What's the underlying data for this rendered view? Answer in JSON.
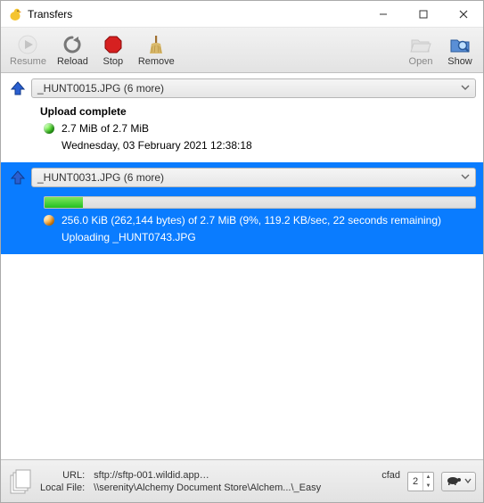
{
  "window": {
    "title": "Transfers"
  },
  "toolbar": {
    "resume": "Resume",
    "reload": "Reload",
    "stop": "Stop",
    "remove": "Remove",
    "open": "Open",
    "show": "Show"
  },
  "transfers": [
    {
      "filename": "_HUNT0015.JPG (6 more)",
      "complete_label": "Upload complete",
      "size_line": "2.7 MiB of 2.7 MiB",
      "time_line": "Wednesday, 03 February 2021 12:38:18",
      "selected": false,
      "status": "done"
    },
    {
      "filename": "_HUNT0031.JPG (6 more)",
      "progress_percent": 9,
      "progress_line": "256.0 KiB (262,144 bytes) of 2.7 MiB (9%, 119.2 KB/sec, 22 seconds remaining)",
      "uploading_line": "Uploading _HUNT0743.JPG",
      "selected": true,
      "status": "active"
    }
  ],
  "statusbar": {
    "url_label": "URL:",
    "url_value": "sftp://sftp-001.wildid.app…",
    "url_tail": "cfad",
    "local_label": "Local File:",
    "local_value": "\\\\serenity\\Alchemy  Document  Store\\Alchem...\\_Easy",
    "connections": "2"
  }
}
